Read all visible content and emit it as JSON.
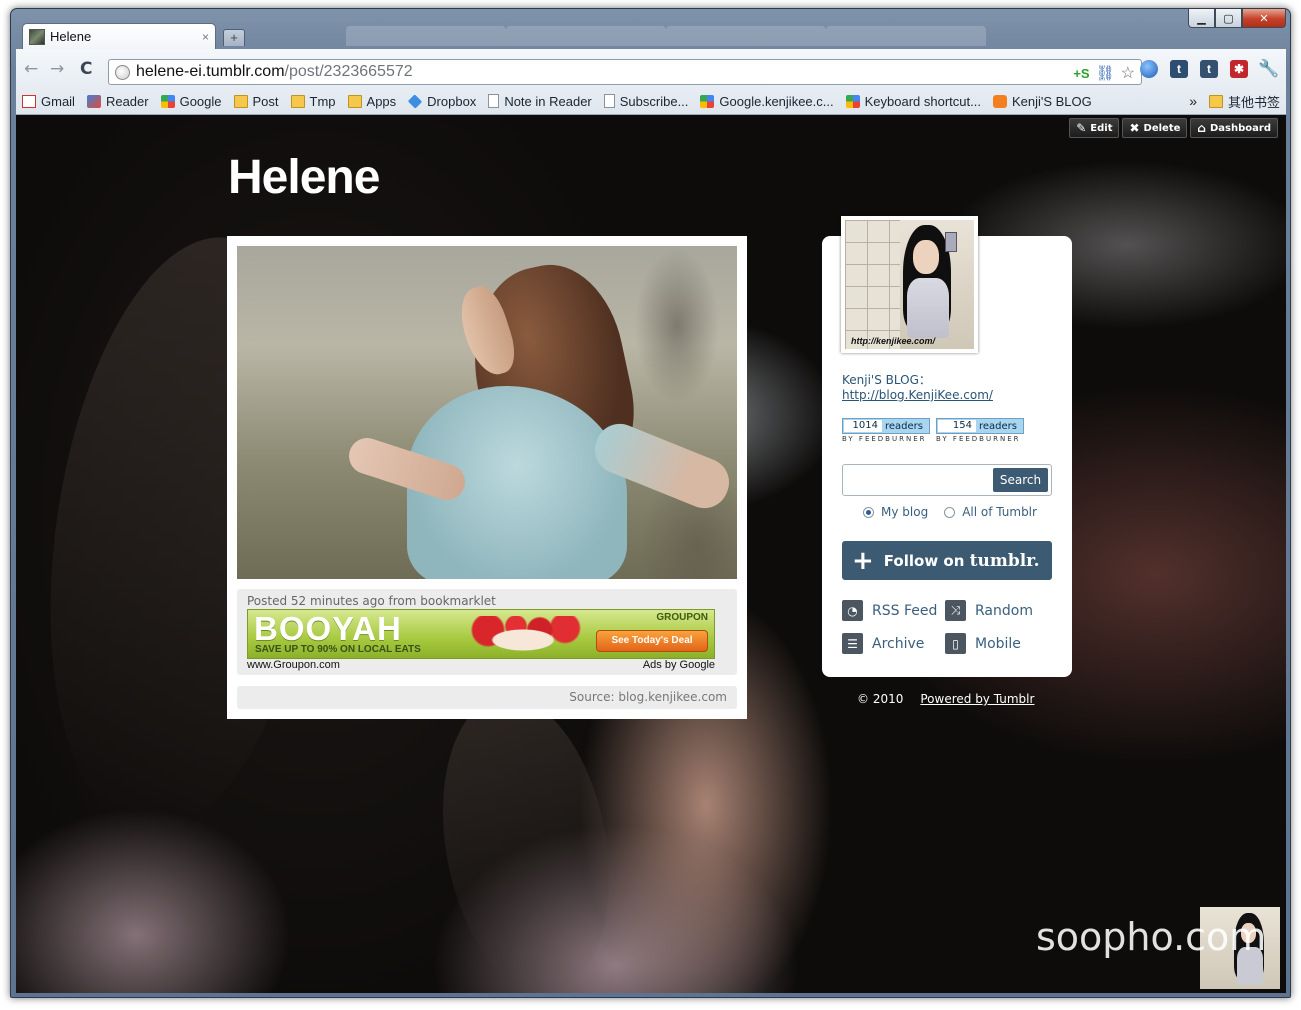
{
  "window": {
    "controls": {
      "minimize": "▁",
      "maximize": "▢",
      "close": "✕"
    }
  },
  "tab": {
    "title": "Helene",
    "close": "×",
    "new_tab": "+"
  },
  "toolbar": {
    "back": "←",
    "forward": "→",
    "reload": "C",
    "url_host": "helene-ei.tumblr.com",
    "url_path": "/post/2323665572",
    "omni_plus": "+S",
    "extensions": [
      "globe-icon",
      "tumblr-count-icon",
      "tumblr-icon",
      "red-ext-icon",
      "wrench-icon"
    ]
  },
  "bookmarks": {
    "items": [
      {
        "label": "Gmail",
        "icon": "gmail-icon"
      },
      {
        "label": "Reader",
        "icon": "reader-icon"
      },
      {
        "label": "Google",
        "icon": "google-icon"
      },
      {
        "label": "Post",
        "icon": "folder-icon"
      },
      {
        "label": "Tmp",
        "icon": "folder-icon"
      },
      {
        "label": "Apps",
        "icon": "folder-icon"
      },
      {
        "label": "Dropbox",
        "icon": "dropbox-icon"
      },
      {
        "label": "Note in Reader",
        "icon": "page-icon"
      },
      {
        "label": "Subscribe...",
        "icon": "page-icon"
      },
      {
        "label": "Google.kenjikee.c...",
        "icon": "google-icon"
      },
      {
        "label": "Keyboard shortcut...",
        "icon": "google-icon"
      },
      {
        "label": "Kenji'S BLOG",
        "icon": "blogger-icon"
      }
    ],
    "more": "»",
    "other": "其他书签"
  },
  "admin": {
    "edit": "Edit",
    "delete": "Delete",
    "dashboard": "Dashboard"
  },
  "blog": {
    "title": "Helene"
  },
  "post": {
    "meta": "Posted 52 minutes ago from bookmarklet",
    "source": "Source: blog.kenjikee.com"
  },
  "ad": {
    "headline": "BOOYAH",
    "sub": "SAVE UP TO 90% ON LOCAL EATS",
    "brand": "GROUPON",
    "cta": "See Today's Deal",
    "url": "www.Groupon.com",
    "ads_by": "Ads by Google"
  },
  "sidebar": {
    "avatar_caption": "http://kenjikee.com/",
    "desc_line1": "Kenji'S BLOG：",
    "desc_link": "http://blog.KenjiKee.com/",
    "feed_badges": [
      {
        "count": "1014",
        "label": "readers",
        "by": "BY FEEDBURNER"
      },
      {
        "count": "154",
        "label": "readers",
        "by": "BY FEEDBURNER"
      }
    ],
    "search_button": "Search",
    "radio_my_blog": "My blog",
    "radio_all": "All of Tumblr",
    "follow_prefix": "Follow on ",
    "follow_brand": "tumblr.",
    "links": [
      {
        "label": "RSS Feed",
        "icon": "rss-icon"
      },
      {
        "label": "Random",
        "icon": "shuffle-icon"
      },
      {
        "label": "Archive",
        "icon": "archive-icon"
      },
      {
        "label": "Mobile",
        "icon": "mobile-icon"
      }
    ]
  },
  "footer": {
    "copyright": "© 2010",
    "powered": "Powered by Tumblr"
  },
  "watermark": "soopho.com"
}
